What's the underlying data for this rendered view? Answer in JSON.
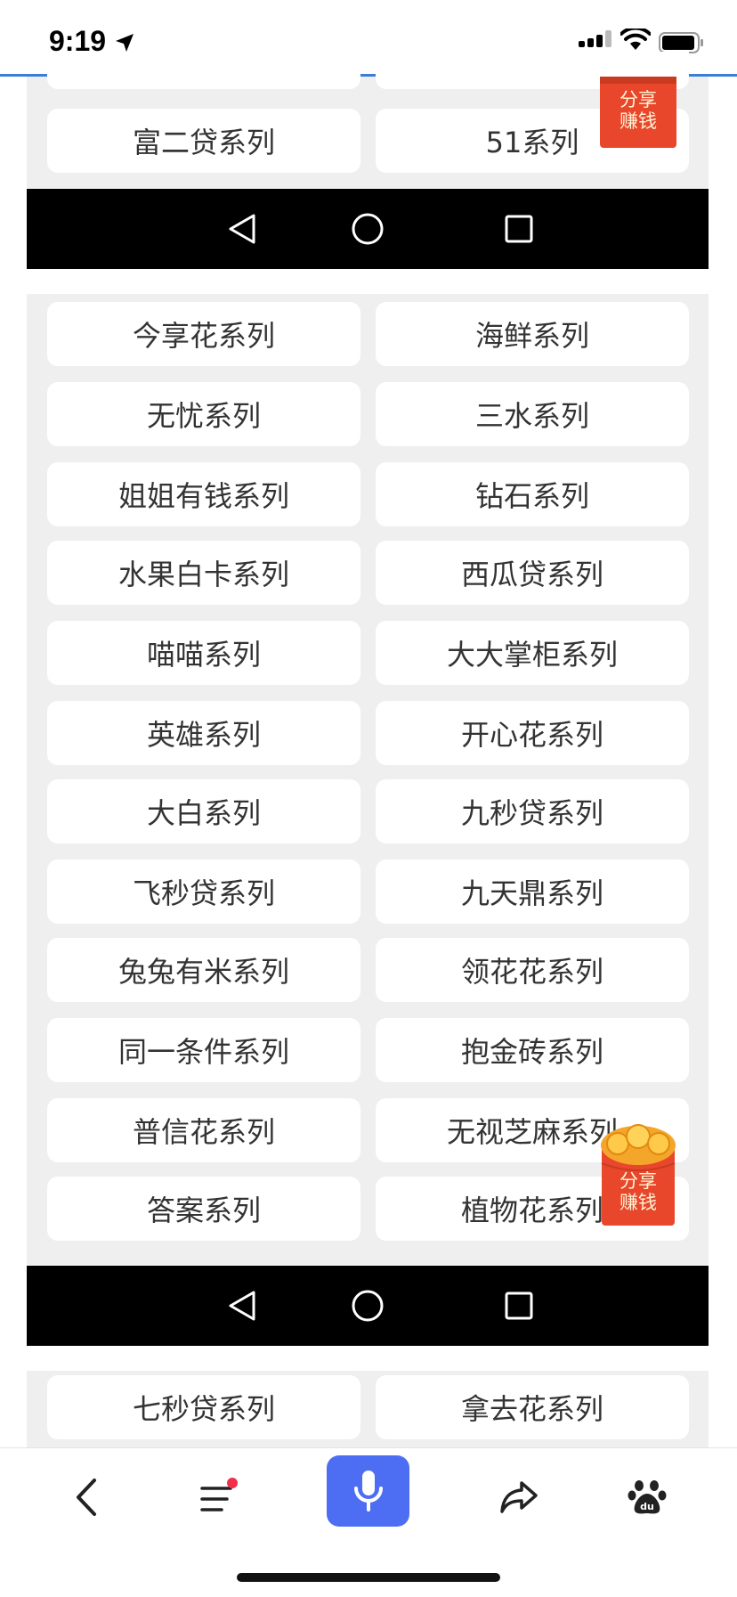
{
  "status_bar": {
    "time": "9:19"
  },
  "float_badge": {
    "line1": "分享",
    "line2": "赚钱"
  },
  "section_top": {
    "items": [
      "富二贷系列",
      "51系列"
    ]
  },
  "section_main": {
    "items": [
      "今享花系列",
      "海鲜系列",
      "无忧系列",
      "三水系列",
      "姐姐有钱系列",
      "钻石系列",
      "水果白卡系列",
      "西瓜贷系列",
      "喵喵系列",
      "大大掌柜系列",
      "英雄系列",
      "开心花系列",
      "大白系列",
      "九秒贷系列",
      "飞秒贷系列",
      "九天鼎系列",
      "兔兔有米系列",
      "领花花系列",
      "同一条件系列",
      "抱金砖系列",
      "普信花系列",
      "无视芝麻系列",
      "答案系列",
      "植物花系列"
    ]
  },
  "section_bottom": {
    "items": [
      "七秒贷系列",
      "拿去花系列"
    ]
  },
  "colors": {
    "accent": "#4d6ef2",
    "badge_red": "#e8472c",
    "notification_dot": "#f0304a"
  }
}
